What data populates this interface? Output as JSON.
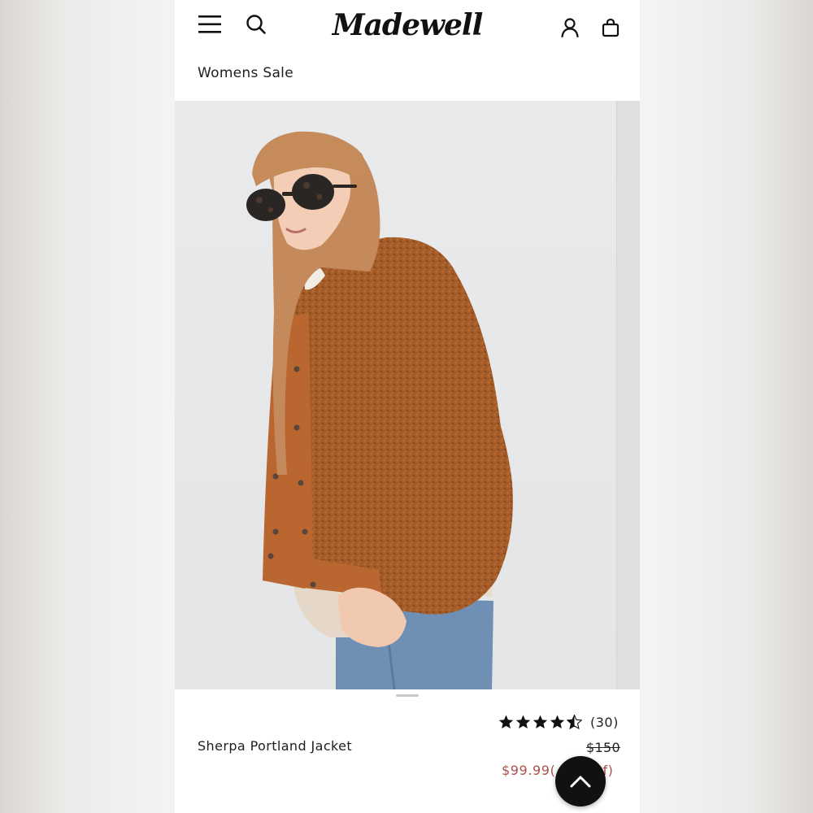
{
  "header": {
    "logo_text": "Madewell",
    "icons": {
      "menu": "hamburger-menu-icon",
      "search": "search-icon",
      "account": "account-icon",
      "bag": "shopping-bag-icon"
    }
  },
  "breadcrumb": {
    "label": "Womens Sale"
  },
  "product": {
    "name": "Sherpa Portland Jacket",
    "rating": {
      "stars": 4.5,
      "max_stars": 5,
      "count_label": "(30)"
    },
    "price_original": "$150",
    "price_sale": "$99.99(",
    "price_sale_tail": "f)"
  },
  "colors": {
    "sale_price": "#a8524a",
    "jacket": "#a25a27",
    "background": "#e9eaec"
  },
  "scroll_top_button": {
    "icon": "chevron-up-icon"
  }
}
